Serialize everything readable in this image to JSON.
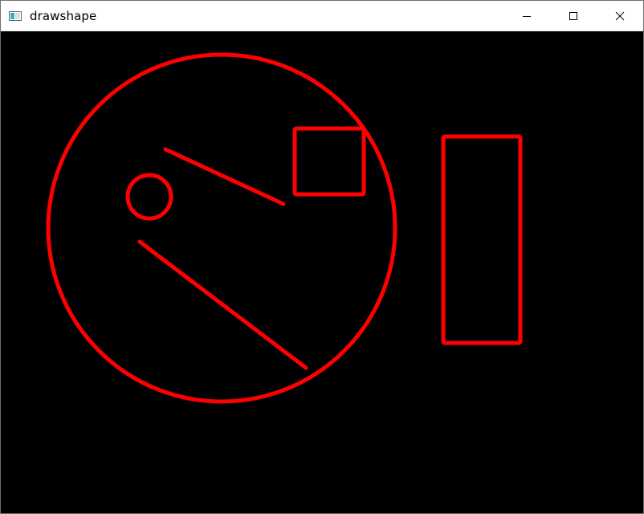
{
  "window": {
    "title": "drawshape",
    "controls": {
      "minimize": "minimize-icon",
      "maximize": "maximize-icon",
      "close": "close-icon"
    }
  },
  "canvas": {
    "background": "#000000",
    "stroke_color": "#ff0000"
  }
}
